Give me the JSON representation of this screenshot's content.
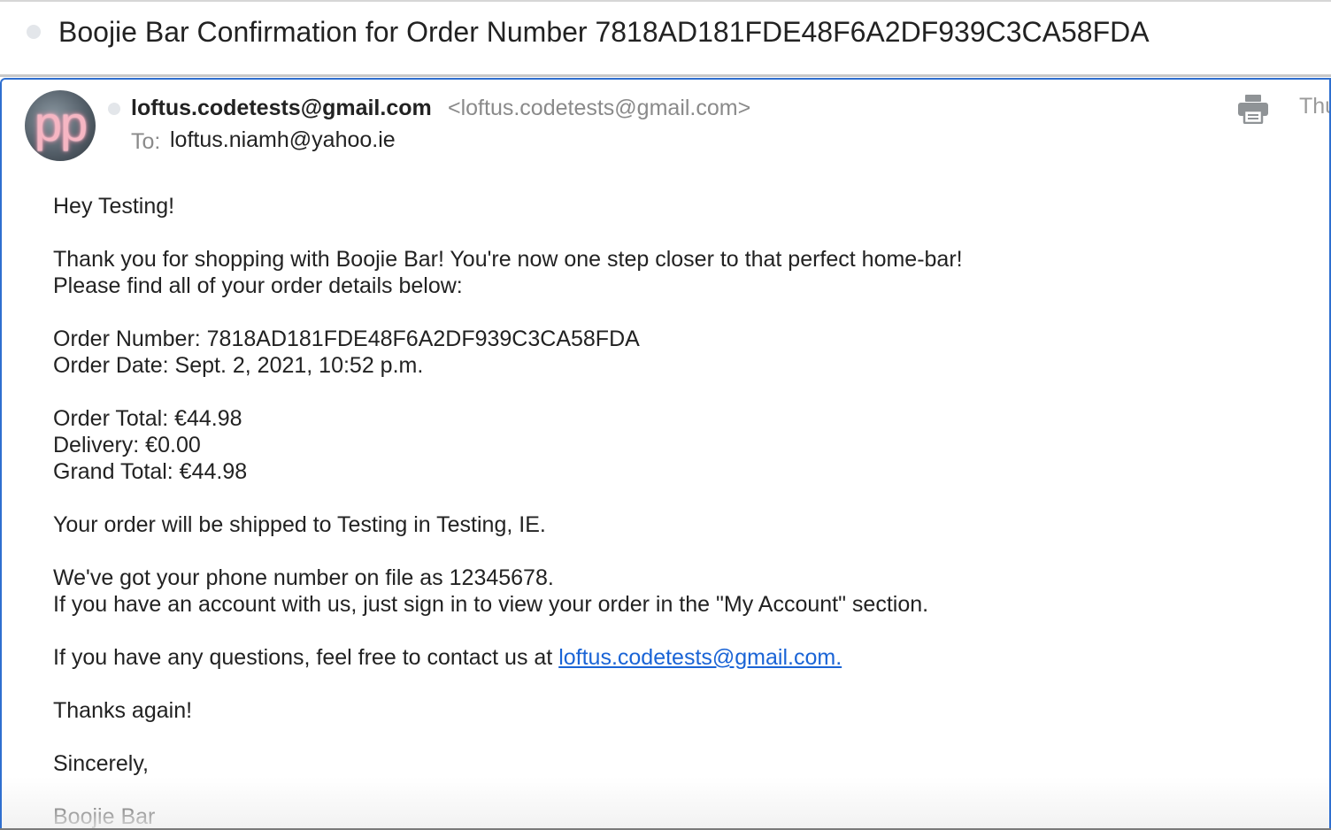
{
  "subject": "Boojie Bar Confirmation for Order Number 7818AD181FDE48F6A2DF939C3CA58FDA",
  "header": {
    "avatar_letters": "pp",
    "sender_name": "loftus.codetests@gmail.com",
    "sender_address": "<loftus.codetests@gmail.com>",
    "to_label": "To:",
    "to_value": "loftus.niamh@yahoo.ie",
    "date": "Thu",
    "print_icon": "printer-icon"
  },
  "body": {
    "greeting": "Hey Testing!",
    "thanks_line1": "Thank you for shopping with Boojie Bar! You're now one step closer to that perfect home-bar!",
    "thanks_line2": "Please find all of your order details below:",
    "order_number": "Order Number: 7818AD181FDE48F6A2DF939C3CA58FDA",
    "order_date": "Order Date: Sept. 2, 2021, 10:52 p.m.",
    "order_total": "Order Total: €44.98",
    "delivery": "Delivery: €0.00",
    "grand_total": "Grand Total: €44.98",
    "shipping": "Your order will be shipped to Testing in Testing, IE.",
    "phone_line": "We've got your phone number on file as 12345678.",
    "account_line": "If you have an account with us, just sign in to view your order in the \"My Account\" section.",
    "contact_prefix": "If you have any questions, feel free to contact us at ",
    "contact_link": "loftus.codetests@gmail.com.",
    "thanks_again": "Thanks again!",
    "sign_off": "Sincerely,",
    "signature": "Boojie Bar"
  },
  "colors": {
    "frame_border": "#2f6fcf",
    "link": "#1a64d6",
    "muted_text": "#8a8a8a"
  }
}
